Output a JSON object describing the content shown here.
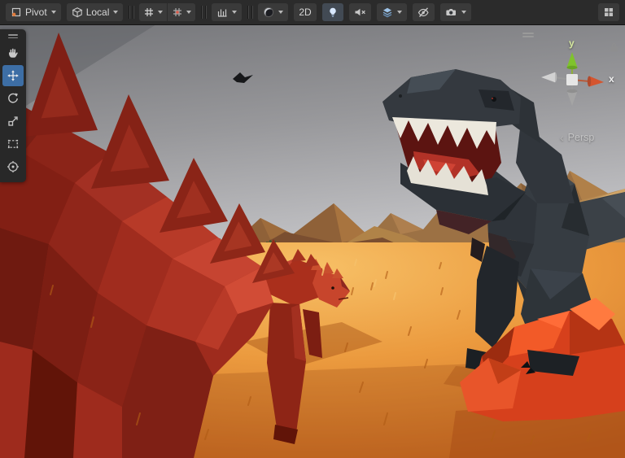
{
  "toolbar": {
    "pivot_label": "Pivot",
    "rotation_label": "Local",
    "mode_2d_label": "2D",
    "icon_names": [
      "pivot-icon",
      "local-cube-icon",
      "grid-visibility-icon",
      "grid-snap-icon",
      "snap-increment-icon",
      "shading-mode-icon",
      "light-bulb-icon",
      "audio-mute-icon",
      "effects-icon",
      "eye-slash-icon",
      "camera-icon",
      "overlays-grid-icon"
    ]
  },
  "tools": {
    "names": [
      "view-hand",
      "move",
      "rotate",
      "scale",
      "rect",
      "transform"
    ],
    "active_tool": "move"
  },
  "gizmo": {
    "y_label": "y",
    "x_label": "x",
    "projection": "Persp"
  },
  "colors": {
    "toolbar_bg": "#2b2b2b",
    "panel_bg": "#282828",
    "button_bg": "#3a3a3a",
    "accent_blue": "#3d6ea5",
    "icon_gray": "#c8c8c8",
    "sky_top": "#717276",
    "sky_bottom": "#c2c2c5",
    "ground_bright": "#f7c066",
    "ground_deep": "#c86a22",
    "stego_red": "#a62f22",
    "trex_gray": "#33383e",
    "rock_orange": "#e04a20",
    "water_blue": "#699fce",
    "axis_x_red": "#d4552f",
    "axis_y_green": "#7fc32c"
  }
}
